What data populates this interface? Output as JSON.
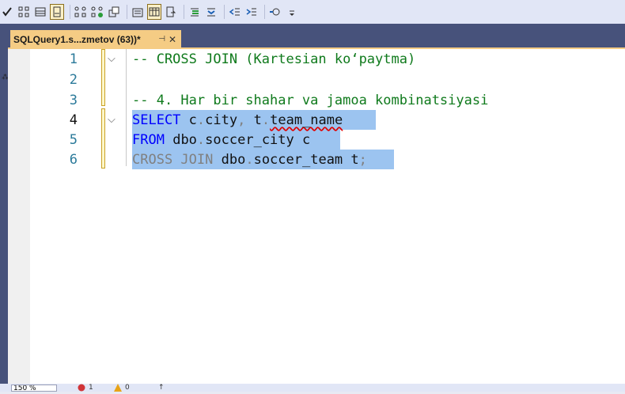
{
  "toolbar": {
    "icons": [
      "check-icon",
      "parse-icon",
      "results-grid-icon",
      "results-file-icon",
      "include-plan-icon",
      "live-stats-icon",
      "client-stats-icon",
      "results-text-icon",
      "results-grid2-icon",
      "results-to-file-icon",
      "comment-icon",
      "uncomment-icon",
      "decrease-indent-icon",
      "increase-indent-icon",
      "specify-values-icon",
      "more-icon"
    ]
  },
  "tab": {
    "title": "SQLQuery1.s...zmetov (63))*",
    "pin": "⊣",
    "close": "✕"
  },
  "editor": {
    "lines": [
      {
        "num": "1",
        "text": "-- CROSS JOIN (Kartesian ko‘paytma)"
      },
      {
        "num": "2",
        "text": ""
      },
      {
        "num": "3",
        "text": "-- 4. Har bir shahar va jamoa kombinatsiyasi"
      },
      {
        "num": "4",
        "kw": "SELECT",
        "a": "c",
        "b": "city",
        "c": "t",
        "d": "team_name"
      },
      {
        "num": "5",
        "kw": "FROM",
        "tbl": "dbo",
        "obj": "soccer_city",
        "alias": "c"
      },
      {
        "num": "6",
        "kw": "CROSS JOIN",
        "tbl": "dbo",
        "obj": "soccer_team",
        "alias": "t"
      }
    ]
  },
  "status": {
    "zoom": "150 %",
    "errors": "1",
    "warnings": "0"
  },
  "colors": {
    "comment": "#0f7a1c",
    "keyword": "#0000ff",
    "selection": "#9cc4f0",
    "tab": "#f5cc84",
    "chrome": "#47527b"
  }
}
